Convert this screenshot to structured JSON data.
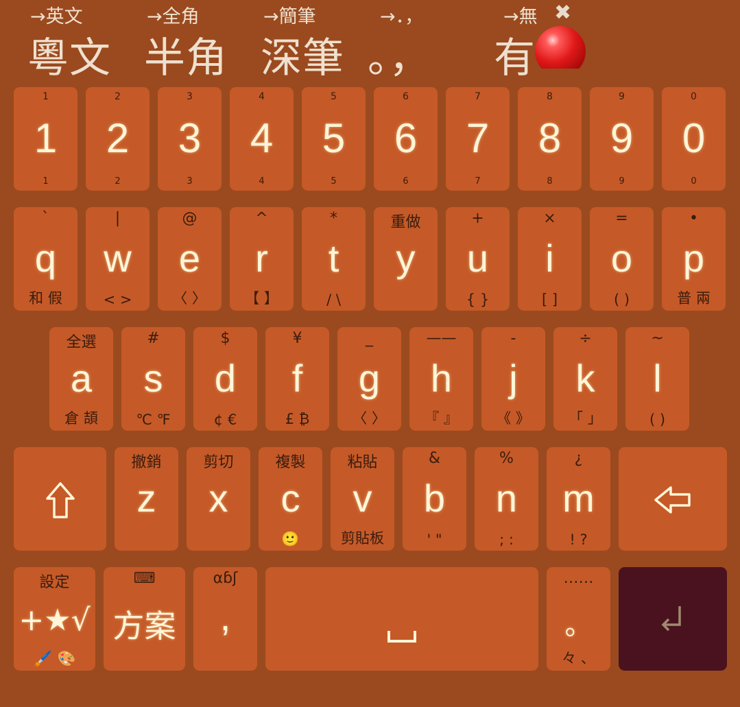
{
  "toggles": [
    {
      "top": "→英文",
      "main": "粵文"
    },
    {
      "top": "→全角",
      "main": "半角"
    },
    {
      "top": "→簡筆",
      "main": "深筆"
    },
    {
      "top": "→．，",
      "main": "。，"
    },
    {
      "top": "→無",
      "main": "有"
    }
  ],
  "toggle_close_glyph": "✖",
  "row1": [
    {
      "sup": "1",
      "label": "1",
      "sub": "1"
    },
    {
      "sup": "2",
      "label": "2",
      "sub": "2"
    },
    {
      "sup": "3",
      "label": "3",
      "sub": "3"
    },
    {
      "sup": "4",
      "label": "4",
      "sub": "4"
    },
    {
      "sup": "5",
      "label": "5",
      "sub": "5"
    },
    {
      "sup": "6",
      "label": "6",
      "sub": "6"
    },
    {
      "sup": "7",
      "label": "7",
      "sub": "7"
    },
    {
      "sup": "8",
      "label": "8",
      "sub": "8"
    },
    {
      "sup": "9",
      "label": "9",
      "sub": "9"
    },
    {
      "sup": "0",
      "label": "0",
      "sub": "0"
    }
  ],
  "row2": [
    {
      "sup": "`",
      "label": "q",
      "sub": "和  假"
    },
    {
      "sup": "|",
      "label": "w",
      "sub": "< >"
    },
    {
      "sup": "@",
      "label": "e",
      "sub": "〈 〉"
    },
    {
      "sup": "^",
      "label": "r",
      "sub": "【 】"
    },
    {
      "sup": "*",
      "label": "t",
      "sub": "/ \\"
    },
    {
      "sup": "重做",
      "label": "y",
      "sub": ""
    },
    {
      "sup": "+",
      "label": "u",
      "sub": "{ }"
    },
    {
      "sup": "×",
      "label": "i",
      "sub": "[ ]"
    },
    {
      "sup": "=",
      "label": "o",
      "sub": "( )"
    },
    {
      "sup": "•",
      "label": "p",
      "sub": "普  兩"
    }
  ],
  "row3": [
    {
      "sup": "全選",
      "label": "a",
      "sub": "倉  頡"
    },
    {
      "sup": "#",
      "label": "s",
      "sub": "℃ ℉"
    },
    {
      "sup": "$",
      "label": "d",
      "sub": "¢ €"
    },
    {
      "sup": "¥",
      "label": "f",
      "sub": "£ ₿"
    },
    {
      "sup": "_",
      "label": "g",
      "sub": "〈 〉"
    },
    {
      "sup": "——",
      "label": "h",
      "sub": "『 』"
    },
    {
      "sup": "-",
      "label": "j",
      "sub": "《 》"
    },
    {
      "sup": "÷",
      "label": "k",
      "sub": "「 」"
    },
    {
      "sup": "~",
      "label": "l",
      "sub": "( )"
    }
  ],
  "row4": {
    "shift_icon": "shift-arrow-icon",
    "keys": [
      {
        "sup": "撤銷",
        "label": "z",
        "sub": ""
      },
      {
        "sup": "剪切",
        "label": "x",
        "sub": ""
      },
      {
        "sup": "複製",
        "label": "c",
        "sub": "🙂"
      },
      {
        "sup": "粘貼",
        "label": "v",
        "sub": "剪貼板"
      },
      {
        "sup": "&",
        "label": "b",
        "sub": "' \""
      },
      {
        "sup": "%",
        "label": "n",
        "sub": "; :"
      },
      {
        "sup": "¿",
        "label": "m",
        "sub": "! ?"
      }
    ],
    "backspace_icon": "backspace-arrow-icon"
  },
  "row5": {
    "settings": {
      "sup": "設定",
      "label": "+★√",
      "sub": "🖌️ 🎨"
    },
    "scheme": {
      "sup": "⌨",
      "label": "方案"
    },
    "comma": {
      "sup": "αɓʃ",
      "label": ","
    },
    "space": {
      "label": "␣"
    },
    "period": {
      "sup": "……",
      "label": "。",
      "sub": "々  、"
    },
    "enter": {
      "label": "↲"
    }
  },
  "colors": {
    "background": "#9a4a1e",
    "key": "#c55a28",
    "enter_key": "#4a121e",
    "label": "#fff5d8",
    "hint": "#3a1c0e"
  }
}
